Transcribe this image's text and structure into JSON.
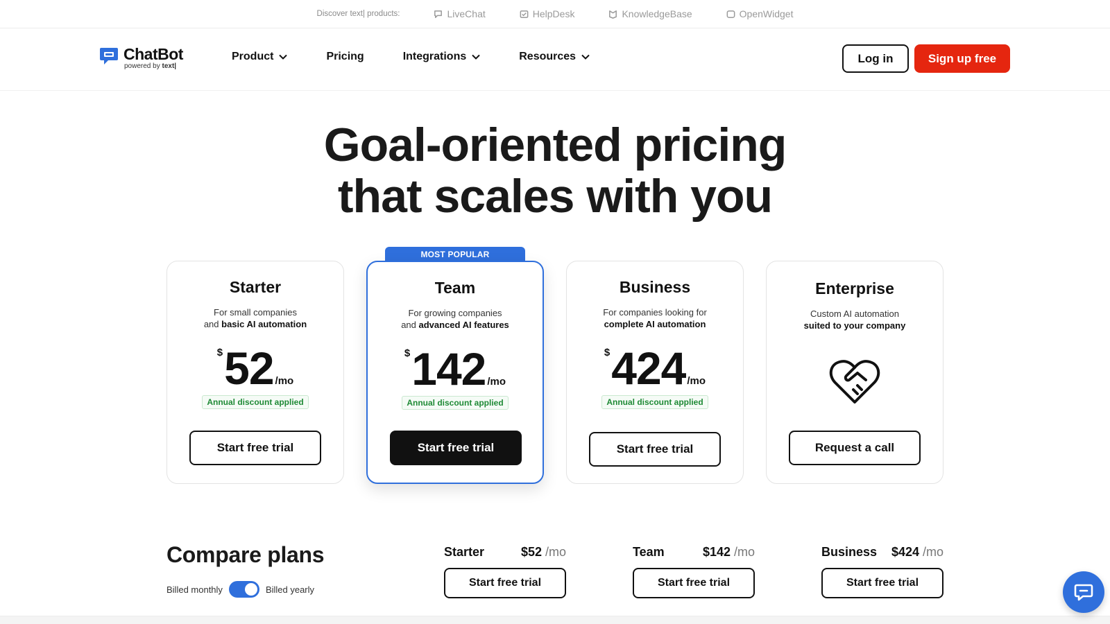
{
  "topstrip": {
    "discover": "Discover text| products:",
    "products": [
      "LiveChat",
      "HelpDesk",
      "KnowledgeBase",
      "OpenWidget"
    ]
  },
  "logo": {
    "name": "ChatBot",
    "powered_prefix": "powered by",
    "powered_brand": "text|"
  },
  "nav": {
    "product": "Product",
    "pricing": "Pricing",
    "integrations": "Integrations",
    "resources": "Resources"
  },
  "header": {
    "login": "Log in",
    "signup": "Sign up free"
  },
  "hero": {
    "line1": "Goal-oriented pricing",
    "line2": "that scales with you"
  },
  "plans": {
    "badge": "MOST POPULAR",
    "starter": {
      "title": "Starter",
      "desc1": "For small companies",
      "desc2a": "and ",
      "desc2b": "basic AI automation",
      "currency": "$",
      "amount": "52",
      "per": "/mo",
      "discount": "Annual discount applied",
      "cta": "Start free trial"
    },
    "team": {
      "title": "Team",
      "desc1": "For growing companies",
      "desc2a": "and ",
      "desc2b": "advanced AI features",
      "currency": "$",
      "amount": "142",
      "per": "/mo",
      "discount": "Annual discount applied",
      "cta": "Start free trial"
    },
    "business": {
      "title": "Business",
      "desc1": "For companies looking for",
      "desc2b": "complete AI automation",
      "currency": "$",
      "amount": "424",
      "per": "/mo",
      "discount": "Annual discount applied",
      "cta": "Start free trial"
    },
    "enterprise": {
      "title": "Enterprise",
      "desc1": "Custom AI automation",
      "desc2b": "suited to your company",
      "cta": "Request a call"
    }
  },
  "compare": {
    "title": "Compare plans",
    "billed_monthly": "Billed monthly",
    "billed_yearly": "Billed yearly",
    "billing_yearly_selected": true,
    "plans": [
      {
        "name": "Starter",
        "price": "$52",
        "per": " /mo",
        "cta": "Start free trial"
      },
      {
        "name": "Team",
        "price": "$142",
        "per": " /mo",
        "cta": "Start free trial"
      },
      {
        "name": "Business",
        "price": "$424",
        "per": " /mo",
        "cta": "Start free trial"
      }
    ]
  },
  "colors": {
    "accent_blue": "#2f6fdc",
    "signup_red": "#e5260f",
    "discount_green": "#1f8a36"
  }
}
